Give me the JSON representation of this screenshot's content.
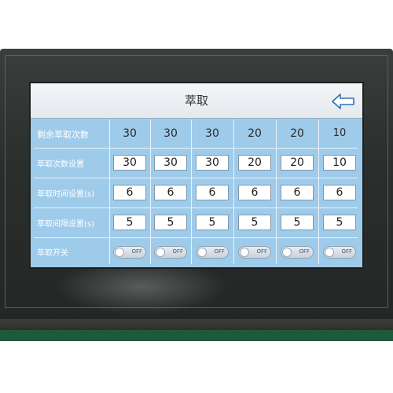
{
  "title": "萃取",
  "back_icon": "left-arrow-icon",
  "rows": {
    "remaining": {
      "label": "剩余萃取次数",
      "values": [
        "30",
        "30",
        "30",
        "20",
        "20",
        "10"
      ]
    },
    "count_setting": {
      "label": "萃取次数设置",
      "values": [
        "30",
        "30",
        "30",
        "20",
        "20",
        "10"
      ]
    },
    "time_setting": {
      "label": "萃取时间设置(s)",
      "values": [
        "6",
        "6",
        "6",
        "6",
        "6",
        "6"
      ]
    },
    "interval_setting": {
      "label": "萃取间隔设置(s)",
      "values": [
        "5",
        "5",
        "5",
        "5",
        "5",
        "5"
      ]
    },
    "switch": {
      "label": "萃取开关",
      "states": [
        "OFF",
        "OFF",
        "OFF",
        "OFF",
        "OFF",
        "OFF"
      ]
    }
  },
  "colors": {
    "screen_bg": "#9fcbea",
    "header_bg": "#eef2f5",
    "toggle_text": "#3d5a78"
  }
}
